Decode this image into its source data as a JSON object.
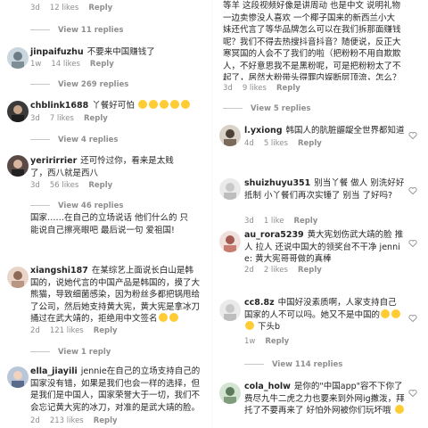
{
  "left": {
    "top_meta": {
      "time": "3d",
      "likes": "12 likes",
      "reply": "Reply"
    },
    "view_replies_1": "View 11 replies",
    "c1": {
      "user": "jinpaifuzhu",
      "text": "不要来中国赚钱了",
      "time": "1w",
      "likes": "14 likes",
      "reply": "Reply"
    },
    "view_replies_2": "View 269 replies",
    "c2": {
      "user": "chblink1688",
      "text": "丫餐好可怕",
      "time": "3d",
      "likes": "7 likes",
      "reply": "Reply"
    },
    "view_replies_3": "View 4 replies",
    "c3": {
      "user": "yeririrrier",
      "text": "还可怜过你，看来是太贱了，西八就是西八",
      "time": "3d",
      "likes": "56 likes",
      "reply": "Reply"
    },
    "view_replies_4": "View 46 replies",
    "partial": "国家……在自己的立场说话 他们什么的 只能说自己擦亮眼吧 最后说一句 爱祖国!",
    "c4": {
      "user": "xiangshi187",
      "text": "在某综艺上面说长白山是韩国的，说她代言的中国产品是韩国的，摸了大熊猫，导致细菌感染，因为粉丝多都把锅甩给了公司，然后她支持黄大宪，黄大宪是拿冰刀捅过在武大靖的，拒绝用中文签名",
      "time": "2d",
      "likes": "121 likes",
      "reply": "Reply"
    },
    "view_replies_5": "View 1 reply",
    "c5": {
      "user": "ella_jiayili",
      "text": "jennie在自己的立场支持自己的国家没有错，如果是我们也会一样的选择，但是我们是中国人，国家荣誉大于一切，我们不会忘记黄大宪的冰刀，对准的是武大靖的脸。",
      "time": "2d",
      "likes": "213 likes",
      "reply": "Reply"
    }
  },
  "right": {
    "partial": "等羊 这段视频好像是讲周动 也是中文 说明礼物一边卖惨没人喜欢 一个椰子国来的新西兰小大妹还代言了等华品牌怎么可以在我们拆那面赚钱呢？我们不得去热搜抖音抖音？随便说，反正大寒冥国的人会不了我们的啦（把粉粉不用自欺欺人，不好意思我不是黑粉呢，可是把粉粉太了不起了，居然大粉带头得罪内娱断层顶流，怎么？是想老板娘再出一次圈吗？）",
    "partial_meta": {
      "time": "3d",
      "likes": "9 likes",
      "reply": "Reply"
    },
    "view_replies_1": "View 5 replies",
    "c1": {
      "user": "l.yxiong",
      "text": "韩国人的肮脏龌龊全世界都知道",
      "time": "4d",
      "likes": "5 likes",
      "reply": "Reply"
    },
    "c2": {
      "user": "shuizhuyu351",
      "text": "别当丫餐 做人 别洗好好抵制 小丫餐们再次实锤了 别当 了好吗?",
      "time": "3d",
      "likes": "1 like",
      "reply": "Reply"
    },
    "c3": {
      "user": "au_rora5239",
      "text": "黄大宪划伤武大靖的脸 推人 拉人 还说中国大的领奖台不干净 jennie: 黄大宪哥哥做的真棒",
      "time": "2d",
      "likes": "2 likes",
      "reply": "Reply"
    },
    "c4": {
      "user": "cc8.8z",
      "text": "中国好没素质啊，人家支持自己国家的人不可以吗。她又不是中国的",
      "time": "1w",
      "likes": "",
      "reply": "Reply",
      "extra": "下头b"
    },
    "view_replies_2": "View 114 replies",
    "c5": {
      "user": "cola_holw",
      "text": "是你的\"中国app\"容不下你了 费尽九牛二虎之力也要来到外网ig撒泼，拜托了不要再来了 好怕外网被你们玩坏哦",
      "time": "2d",
      "likes": "",
      "reply": "Reply"
    }
  },
  "colors": {
    "text": "#262626",
    "meta": "#8e8e8e",
    "line": "#c7c7c7",
    "emoji": "#ffcc33"
  }
}
